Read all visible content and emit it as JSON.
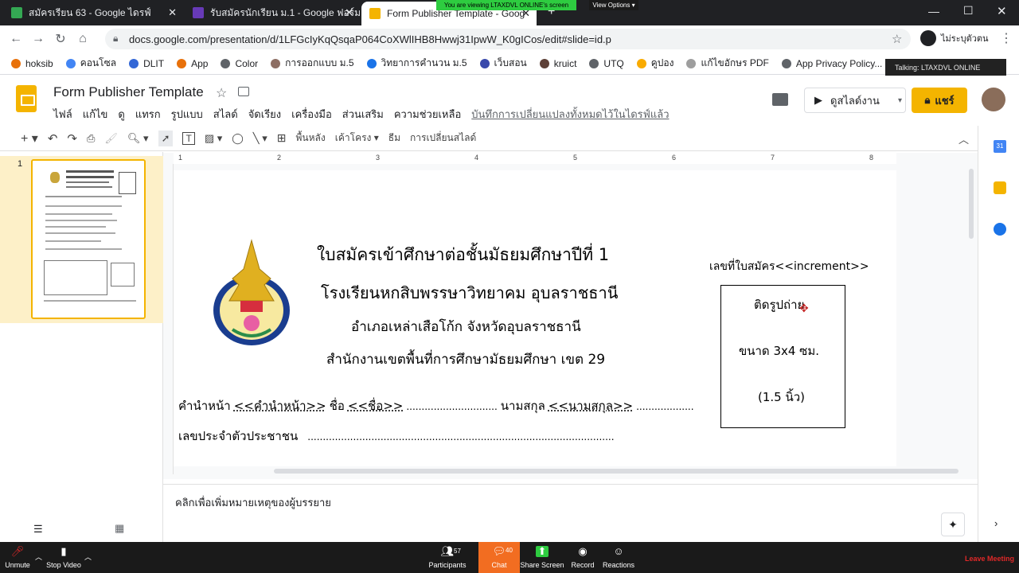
{
  "browser": {
    "tabs": [
      {
        "title": "สมัครเรียน 63 - Google ไดรฟ์",
        "favicon_color": "#34a853"
      },
      {
        "title": "รับสมัครนักเรียน ม.1 - Google ฟอร์ม",
        "favicon_color": "#673ab7"
      },
      {
        "title": "Form Publisher Template - Goog",
        "favicon_color": "#f4b400"
      }
    ],
    "url": "docs.google.com/presentation/d/1LFGcIyKqQsqaP064CoXWlIHB8Hwwj31IpwW_K0gICos/edit#slide=id.p",
    "profile_label": "ไม่ระบุตัวตน",
    "bookmarks": [
      {
        "label": "hoksib",
        "color": "#e8710a"
      },
      {
        "label": "คอนโซล",
        "color": "#4285f4"
      },
      {
        "label": "DLIT",
        "color": "#3367d6"
      },
      {
        "label": "App",
        "color": "#e8710a"
      },
      {
        "label": "Color",
        "color": "#5f6368"
      },
      {
        "label": "การออกแบบ ม.5",
        "color": "#8d6e63"
      },
      {
        "label": "วิทยาการคำนวน ม.5",
        "color": "#1a73e8"
      },
      {
        "label": "เว็บสอน",
        "color": "#3949ab"
      },
      {
        "label": "kruict",
        "color": "#5d4037"
      },
      {
        "label": "UTQ",
        "color": "#5f6368"
      },
      {
        "label": "คูปอง",
        "color": "#f9ab00"
      },
      {
        "label": "แก้ไขอักษร PDF",
        "color": "#9e9e9e"
      },
      {
        "label": "App Privacy Policy...",
        "color": "#5f6368"
      }
    ]
  },
  "zoom_overlay": {
    "viewing_banner": "You are viewing LTAXDVL ONLINE's screen",
    "view_options": "View Options",
    "talking": "Talking: LTAXDVL ONLINE"
  },
  "slides": {
    "doc_title": "Form Publisher Template",
    "menu": [
      "ไฟล์",
      "แก้ไข",
      "ดู",
      "แทรก",
      "รูปแบบ",
      "สไลด์",
      "จัดเรียง",
      "เครื่องมือ",
      "ส่วนเสริม",
      "ความช่วยเหลือ"
    ],
    "save_status": "บันทึกการเปลี่ยนแปลงทั้งหมดไว้ในไดรฟ์แล้ว",
    "present_label": "ดูสไลด์งาน",
    "share_label": "แชร์",
    "toolbar_labels": {
      "background": "พื้นหลัง",
      "layout": "เค้าโครง",
      "theme": "ธีม",
      "transition": "การเปลี่ยนสไลด์"
    },
    "ruler_numbers": [
      "1",
      "2",
      "3",
      "4",
      "5",
      "6",
      "7",
      "8"
    ],
    "slide_number": "1",
    "notes_placeholder": "คลิกเพื่อเพิ่มหมายเหตุของผู้บรรยาย"
  },
  "slide_content": {
    "title_line1": "ใบสมัครเข้าศึกษาต่อชั้นมัธยมศึกษาปีที่ 1",
    "title_line2": "โรงเรียนหกสิบพรรษาวิทยาคม อุบลราชธานี",
    "title_line3": "อำเภอเหล่าเสือโก้ก จังหวัดอุบลราชธานี",
    "title_line4": "สำนักงานเขตพื้นที่การศึกษามัธยมศึกษา เขต 29",
    "application_no": "เลขที่ใบสมัคร<<increment>>",
    "photo_line1": "ติดรูปถ่าย",
    "photo_line2": "ขนาด 3x4 ซม.",
    "photo_line3": "(1.5 นิ้ว)",
    "row1": {
      "prefix_label": "คำนำหน้า",
      "prefix_field": "<<คำนำหน้า>>",
      "name_label": "ชื่อ",
      "name_field": "<<ชื่อ>>",
      "dots1": "..............................",
      "surname_label": "นามสกุล",
      "surname_field": "<<นามสกุล>>",
      "dots2": "..................."
    },
    "row2": {
      "id_label": "เลขประจำตัวประชาชน",
      "dots": "....................................................................................................."
    }
  },
  "zoom_controls": [
    {
      "label": "Unmute",
      "key": "unmute"
    },
    {
      "label": "Stop Video",
      "key": "video"
    },
    {
      "label": "Participants",
      "key": "participants",
      "count": "57"
    },
    {
      "label": "Chat",
      "key": "chat",
      "count": "40"
    },
    {
      "label": "Share Screen",
      "key": "share"
    },
    {
      "label": "Record",
      "key": "record"
    },
    {
      "label": "Reactions",
      "key": "reactions"
    }
  ],
  "leave_label": "Leave Meeting",
  "colors": {
    "accent": "#f4b400",
    "zoom_chat": "#f26d21",
    "share_green": "#2ecc40",
    "leave_red": "#e02828"
  }
}
